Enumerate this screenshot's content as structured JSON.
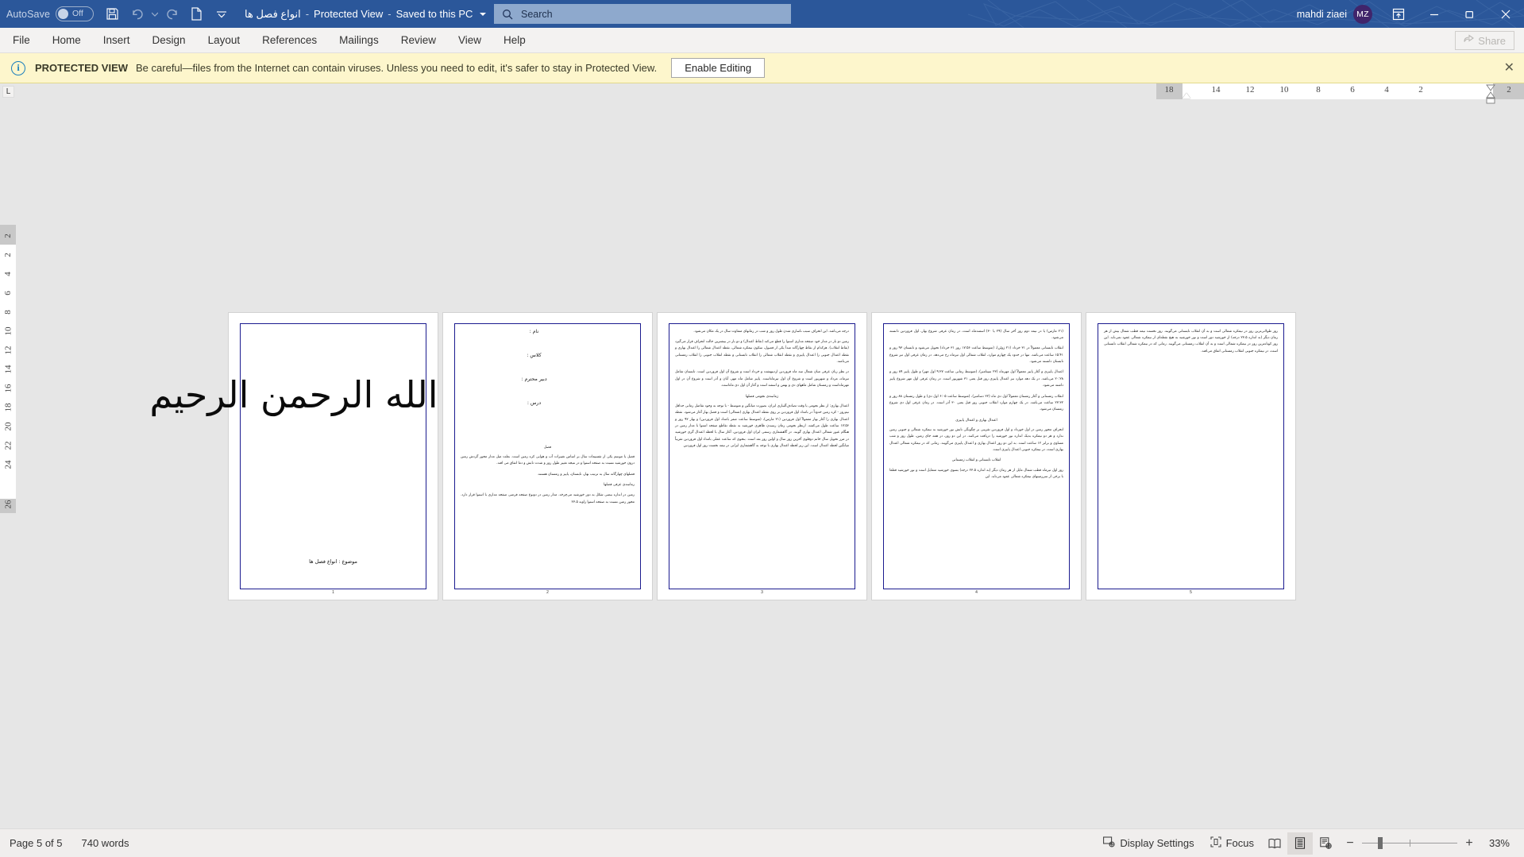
{
  "titlebar": {
    "autosave_label": "AutoSave",
    "autosave_state": "Off",
    "save_icon": "save-icon",
    "undo_icon": "undo-icon",
    "redo_icon": "redo-icon",
    "new_icon": "new-document-icon",
    "customize_icon": "customize-quick-access-icon",
    "doc_title": "انواع فصل ها",
    "sep1": "-",
    "protected_view": "Protected View",
    "sep2": "-",
    "saved_state": "Saved to this PC",
    "account_name": "mahdi ziaei",
    "avatar_initials": "MZ",
    "ribbon_display_icon": "ribbon-display-options-icon",
    "minimize_icon": "minimize-icon",
    "restore_icon": "restore-icon",
    "close_icon": "close-icon",
    "accent_color": "#2b579a",
    "search_bg": "#8ea9cd",
    "avatar_color": "#40256b"
  },
  "search": {
    "icon": "search-icon",
    "placeholder": "Search"
  },
  "ribbon": {
    "tabs": [
      {
        "label": "File"
      },
      {
        "label": "Home"
      },
      {
        "label": "Insert"
      },
      {
        "label": "Design"
      },
      {
        "label": "Layout"
      },
      {
        "label": "References"
      },
      {
        "label": "Mailings"
      },
      {
        "label": "Review"
      },
      {
        "label": "View"
      },
      {
        "label": "Help"
      }
    ],
    "share_label": "Share",
    "share_icon": "share-icon",
    "share_disabled": true
  },
  "protected_view": {
    "info_icon": "info-icon",
    "title": "PROTECTED VIEW",
    "message": "Be careful—files from the Internet can contain viruses. Unless you need to edit, it's safer to stay in Protected View.",
    "enable_label": "Enable Editing",
    "close_icon": "close-icon",
    "bg_color": "#fdf6cc"
  },
  "ruler": {
    "corner_label": "L",
    "horizontal_numbers": [
      "18",
      "14",
      "12",
      "10",
      "8",
      "6",
      "4",
      "2",
      "2"
    ],
    "vertical_numbers": [
      "2",
      "2",
      "4",
      "6",
      "8",
      "10",
      "12",
      "14",
      "16",
      "18",
      "20",
      "22",
      "24",
      "26"
    ]
  },
  "document": {
    "pages": [
      {
        "number": "1",
        "type": "cover",
        "bismillah": "بسم الله الرحمن الرحیم",
        "subject": "موضوع : انواع فصل ها"
      },
      {
        "number": "2",
        "type": "form",
        "fields": [
          "نام :",
          "کلاس :",
          "دبیر محترم :",
          "درس :"
        ],
        "heading": "فصل",
        "paragraphs": [
          "فصل یا موسم یکی از تقسیمات سال بر اساس تغییرات آب و هوایی کره زمین است. بعلت میل مدار محور گردش زمین درون خورشید نسبت به صفحه استوا و در نتیجه تغییر طول روز و شدت تابش و دما اتفاق می افتد.",
          "فصلهای چهارگانه سال به ترتیب بهار، تابستان، پاییز و زمستان هستند.",
          "زمانبندی عرفی فصلها",
          "زمین در اندازه بیضی شکل به دور خورشید می‌چرخد. مدار زمین در دونوع صفحه فرضی صفحه مداری با استوا قرار دارد. محور زمین نسبت به صفحه استوا زاویه ۲۳.۵"
        ]
      },
      {
        "number": "3",
        "type": "text",
        "paragraphs": [
          "درجه می‌باشد. این انحراف سبب ناسازی شدن طول روز و شب در زمانهای متفاوت سال در یک مکان می‌شود.",
          "زمین دو بار در مدار خود صفحه مداری استوا را قطع می‌کند (نقاط اعتدال) و دو بار در بیشترین حالت انحراف قرار می‌گیرد (نقاط انقلاب). هرکدام از نقاط چهارگانه مبدأ یکی از فصول، سکون نیمکره شمالی، نقطه اعتدال شمالی را اعتدال بهاری و نقطه اعتدال جنوبی را اعتدال پاییزی و نقطه انقلاب شمالی را انقلاب تابستانی و نقطه انقلاب جنوبی را انقلاب زمستانی می‌نامند.",
          "در نظر زبان عرفی میان شمال سه ماه فروردین اردیبهشت و خرداد است و شروع آن اول فروردین است. تابستان شامل تیرماه، مرداد و شهریور است و شروع آن اول تیرماه‌است. پاییز شامل ماه مهر، آبان و آذر است و شروع آن در اول مهرماه‌است و زمستان شامل ماههای دی و بهمن و اسفند است و آغاز آن اول دی ماه‌است.",
          "زمانبندی نجومی فصلها",
          "اعتدال بهاری: از نظر نجومی یا وقت تصادف‌آلبیاری ایران، بصورت میانگین و متوسط - با توجه به وجود تقاضل زمانی حداقل نیم‌روز - کره زمین حدوداً در بامداد اول فروردین بر روی نقطه اعتدال بهاری (شمالی) است و فصل بهار آغاز می‌شود. نقطه اعتدال بهاری را آغاز بهار معمولاً اول فروردین (۲۱ مارس)، (متوسط ساعت صفر بامداد اول فروردین) و بهار ۹۲ روز و ۱۷:۵۶ ساعت طول می‌کشد. ازنظر نجومی زمان رسیدن ظاهری خورشید به نقطه تقاطع صفحه استوا با مدار زمین در هنگام عبور شمالی اعتدال بهاری گویند. در گاهشماری رسمی ایران اول فروردین، آغاز سال با لحظه اعتدال گری خورشید در مرز تحویل سال خانم دوقلوی آخرین روز سال و اولین روز بعد است. بنحوی که ساعت عملی بامداد اول فروردین تقریباً میانگین لحظه اعتدال است. این زیر لحظه اعتدال بهاری با توجه به گاهشماری ایرانی در نیمه نخست روز اول فروردین"
        ]
      },
      {
        "number": "4",
        "type": "text",
        "paragraphs": [
          "(۲۱ مارس) یا در نیمه دوم روز آخر سال (۲۹ یا ۳۰) اسفندماه است، در زمان عرفی شروع بهار، اول فروردین دانسته می‌شود.",
          "انقلاب تابستانی معمولاً در ۳۱ خرداد (۲۱ ژوئن)، (متوسط ساعت ۱۷:۵۶ روز ۳۱ خرداد) تحویل می‌شود و تابستان ۹۳ روز و ۱۵:۴۱ ساعت می‌باشد. تنها در حدود یک چهارم موارد، انقلاب شمالی اول تیرماه رخ می‌دهد. در زمان عرفی اول تیر شروع تابستان دانسته می‌شود.",
          "اعتدال پاییزی و آغاز پاییز معمولاً اول مهرماه (۲۳ سپتامبر)، (متوسط زمانی ساعت ۹:۳۷ اول مهر) و طول پاییز ۸۹ روز و ۲۰:۲۸ می‌باشد. در یک دهه موارد نیز اعتدال پاییزی روز قبل یعنی ۳۱ شهریور است. در زمان عرفی اول مهر شروع پاییز داشته می‌شود.",
          "انقلاب زمستانی و آغاز زمستان معمولاً اول دی ماه (۲۲ دسامبر)، (متوسط ساعت ۶:۰۵ اول دی) و طول زمستان ۸۸ روز و ۲۳:۳۲ ساعت می‌باشد. در یک چهارم موارد انقلاب جنوبی روز قبل یعنی ۳۰ آذر است. در زمان عرفی اول دی شروع زمستان می‌شود.",
          "اعتدال بهاری و اعتدال پاییزی",
          "انحراف محور زمین در اول خورداد و اول فروردین تقریبی بر چگونگی تابش نور خورشید به نیمکره شمالی و جنوبی زمین ندارد و هر دو نیمکره به‌یک اندازه نور خورشید را دریافت می‌کنند. در این دو روز، در همه جای زمین، طول روز و شب مساوی و برابر ۱۲ ساعت است. به این دو روز اعتدال بهاری و اعتدال پاییزی می‌گویند. زمانی که در نیمکره شمالی اعتدال بهاری است، در نیمکره جنوبی اعتدال پاییزی است.",
          "انقلاب تابستانی و انقلاب زمستانی",
          "روز اول تیرماه قطب شمال مایل از هر زمان دیگر (به اندازه ۲۳.۵ درجه) بسوی خورشید متمایل است و نور خورشید قطعا با برخی از سرزمینهای نیمکره شمالی عمود می‌تابد. این"
        ]
      },
      {
        "number": "5",
        "type": "text",
        "paragraphs": [
          "روز طولانی‌ترین روز در نیمکره شمالی است و به آن انقلاب تابستانی می‌گویند. روز نخست نیمه قطب شمال بیش از هر زمان دیگر (به اندازه ۲۳.۵ درجه) از خورشید دور است و نور خورشید به هیچ نقطه‌ای از نیمکره شمالی عمود نمی‌تابد. این روز کوتاه‌ترین روز در نیمکره شمالی است و به آن انقلاب زمستانی می‌گویند. زمانی که در نیمکره شمالی انقلاب تابستانی است، در نیمکره جنوبی انقلاب زمستانی اتفاق می‌افتد."
        ]
      }
    ]
  },
  "statusbar": {
    "page_indicator": "Page 5 of 5",
    "word_count": "740 words",
    "display_settings_label": "Display Settings",
    "display_settings_icon": "display-settings-icon",
    "focus_label": "Focus",
    "focus_icon": "focus-icon",
    "read_mode_icon": "read-mode-icon",
    "print_layout_icon": "print-layout-icon",
    "web_layout_icon": "web-layout-icon",
    "zoom_out_icon": "zoom-out-icon",
    "zoom_in_icon": "zoom-in-icon",
    "zoom_level": "33%"
  }
}
